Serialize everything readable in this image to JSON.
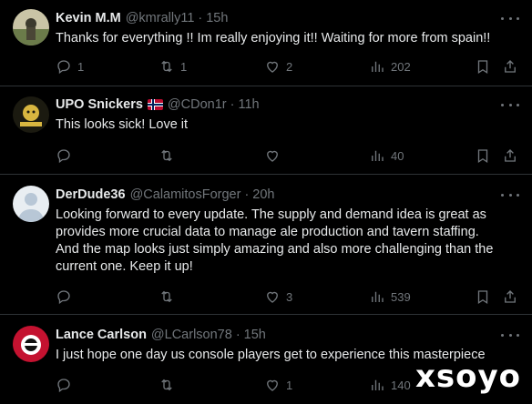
{
  "tweets": [
    {
      "name": "Kevin M.M",
      "handle": "@kmrally11",
      "sep": "·",
      "time": "15h",
      "text": "Thanks for everything !! Im really enjoying it!! Waiting for more from spain!!",
      "replies": "1",
      "retweets": "1",
      "likes": "2",
      "views": "202",
      "avatar_colors": [
        "#6b7b4a",
        "#c9c4a6"
      ]
    },
    {
      "name": "UPO Snickers",
      "handle": "@CDon1r",
      "sep": "·",
      "time": "11h",
      "flag": "norway-flag",
      "text": "This looks sick! Love it",
      "replies": "",
      "retweets": "",
      "likes": "",
      "views": "40",
      "avatar_colors": [
        "#1b1a10",
        "#d8b640"
      ]
    },
    {
      "name": "DerDude36",
      "handle": "@CalamitosForger",
      "sep": "·",
      "time": "20h",
      "text_lines": [
        "Looking forward to every update. The supply and demand idea is great as",
        "provides more crucial data to manage ale production and tavern staffing.",
        "And the map looks just simply amazing and also more challenging than the",
        "current one. Keep it up!"
      ],
      "replies": "",
      "retweets": "",
      "likes": "3",
      "views": "539",
      "avatar_colors": [
        "#b8c7d6",
        "#e9eef2"
      ]
    },
    {
      "name": "Lance Carlson",
      "handle": "@LCarlson78",
      "sep": "·",
      "time": "15h",
      "text": "I just hope one day us console players get to experience this masterpiece",
      "replies": "",
      "retweets": "",
      "likes": "1",
      "views": "140",
      "avatar_colors": [
        "#c41230",
        "#ffffff"
      ]
    }
  ],
  "watermark": "xsoyo",
  "colors": {
    "background": "#000000",
    "text": "#e7e9ea",
    "muted": "#71767b",
    "divider": "#2f3336"
  }
}
